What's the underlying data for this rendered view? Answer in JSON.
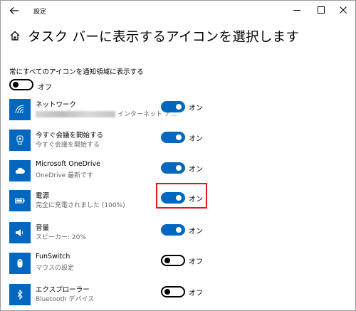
{
  "window": {
    "title": "設定",
    "back_icon": "arrow-left-icon",
    "controls": [
      "minimize-icon",
      "maximize-icon",
      "close-icon"
    ]
  },
  "header": {
    "title": "タスク バーに表示するアイコンを選択します",
    "icon": "home-icon"
  },
  "always_show": {
    "label": "常にすべてのアイコンを通知領域に表示する",
    "state": "オフ",
    "on": false
  },
  "items": [
    {
      "name": "ネットワーク",
      "sub": "インターネット ア...",
      "state": "オン",
      "on": true,
      "icon": "network-icon"
    },
    {
      "name": "今すぐ会議を開始する",
      "sub": "今すぐ会議を開始する",
      "state": "オン",
      "on": true,
      "icon": "meet-now-icon"
    },
    {
      "name": "Microsoft OneDrive",
      "sub": "OneDrive 最新です",
      "state": "オン",
      "on": true,
      "icon": "cloud-icon"
    },
    {
      "name": "電源",
      "sub": "完全に充電されました (100%)",
      "state": "オン",
      "on": true,
      "icon": "battery-icon"
    },
    {
      "name": "音量",
      "sub": "スピーカー: 20%",
      "state": "オン",
      "on": true,
      "icon": "speaker-icon"
    },
    {
      "name": "FunSwitch",
      "sub": "マウスの設定",
      "state": "オフ",
      "on": false,
      "icon": "mouse-icon"
    },
    {
      "name": "エクスプローラー",
      "sub": "Bluetooth デバイス",
      "state": "オフ",
      "on": false,
      "icon": "bluetooth-icon"
    }
  ],
  "colors": {
    "accent": "#0067c0",
    "highlight": "#e8141b"
  }
}
